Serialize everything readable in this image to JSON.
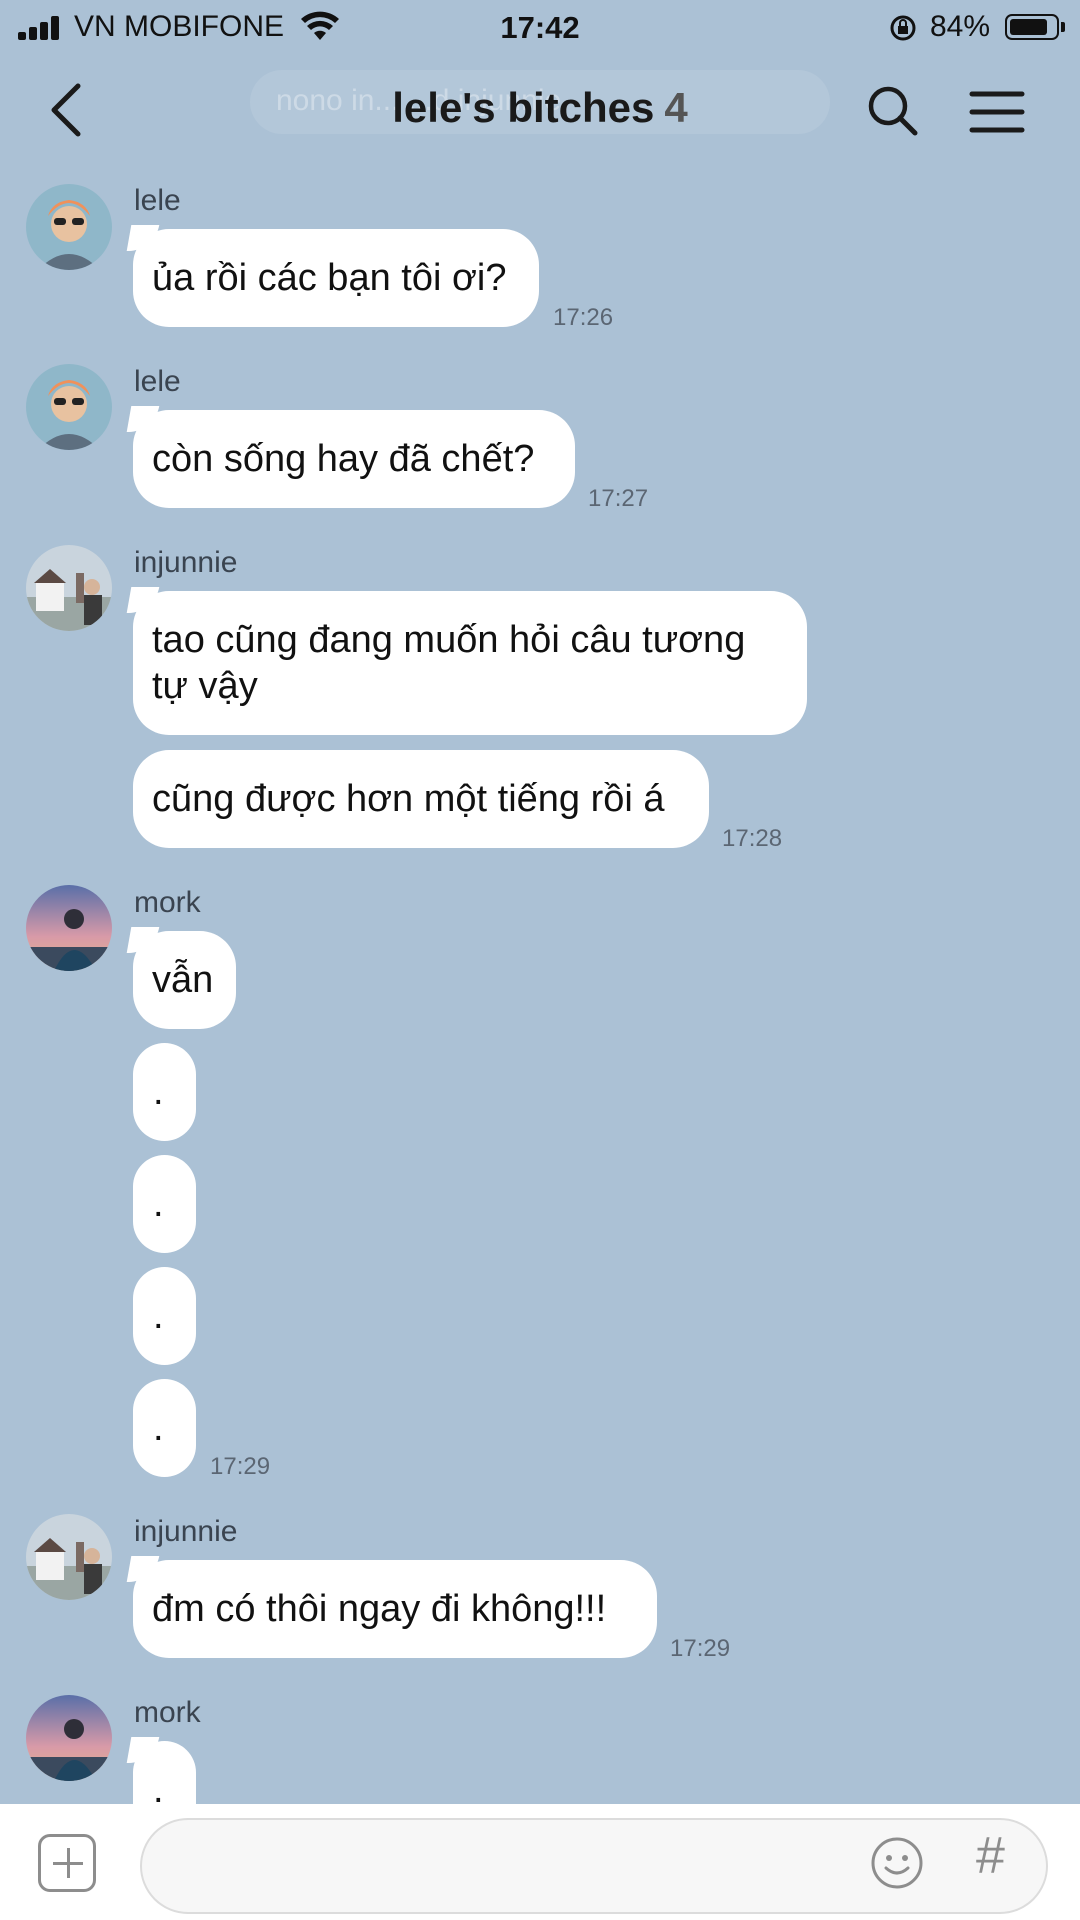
{
  "status_bar": {
    "carrier": "VN MOBIFONE",
    "time": "17:42",
    "battery": "84%",
    "battery_level": 0.84
  },
  "nav": {
    "title": "lele's bitches",
    "member_count": "4",
    "ghost_text": "nono in... ...d injunnie."
  },
  "messages": [
    {
      "sender": "lele",
      "texts": [
        "ủa rồi các bạn tôi ơi?"
      ],
      "time": "17:26"
    },
    {
      "sender": "lele",
      "texts": [
        "còn sống hay đã chết?"
      ],
      "time": "17:27"
    },
    {
      "sender": "injunnie",
      "texts": [
        "tao cũng đang muốn hỏi câu tương tự vậy",
        "cũng được hơn một tiếng rồi á"
      ],
      "time": "17:28"
    },
    {
      "sender": "mork",
      "texts": [
        "vẫn",
        ".",
        ".",
        ".",
        "."
      ],
      "time": "17:29"
    },
    {
      "sender": "injunnie",
      "texts": [
        "đm có thôi ngay đi không!!!"
      ],
      "time": "17:29"
    },
    {
      "sender": "mork",
      "texts": [
        "."
      ],
      "time": ""
    }
  ],
  "input": {
    "placeholder": "",
    "plus_icon": "plus-square-icon",
    "emoji_icon": "smiley-icon",
    "hashtag": "#"
  },
  "colors": {
    "background": "#abc1d5",
    "bubble": "#ffffff"
  }
}
